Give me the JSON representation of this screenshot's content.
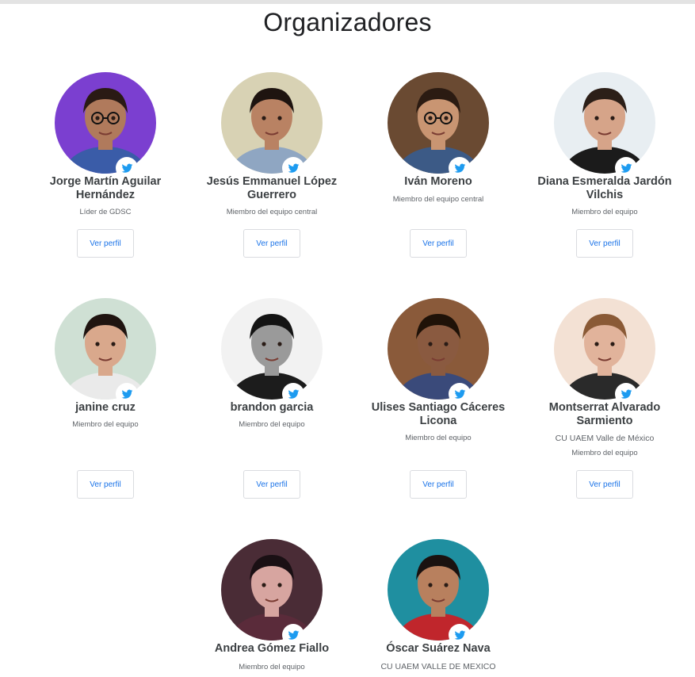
{
  "title": "Organizadores",
  "button_label": "Ver perfil",
  "members": [
    {
      "name": "Jorge Martín Aguilar Hernández",
      "role": "Líder de GDSC",
      "org": "",
      "photo": {
        "bg": "#7b3fd0",
        "skin": "#b07a5c",
        "hair": "#2a1a14",
        "shirt": "#3a5ca8",
        "glasses": true
      }
    },
    {
      "name": "Jesús Emmanuel López Guerrero",
      "role": "Miembro del equipo central",
      "org": "",
      "photo": {
        "bg": "#d8d2b4",
        "skin": "#b98263",
        "hair": "#1e1410",
        "shirt": "#8fa6c2",
        "glasses": false
      }
    },
    {
      "name": "Iván Moreno",
      "role": "Miembro del equipo central",
      "org": "",
      "photo": {
        "bg": "#6a4a32",
        "skin": "#c99572",
        "hair": "#2b1b12",
        "shirt": "#3c5a86",
        "glasses": true
      }
    },
    {
      "name": "Diana Esmeralda Jardón Vilchis",
      "role": "Miembro del equipo",
      "org": "",
      "photo": {
        "bg": "#e8eef2",
        "skin": "#d6a489",
        "hair": "#2c1f18",
        "shirt": "#1b1b1b",
        "glasses": false
      }
    },
    {
      "name": "janine cruz",
      "role": "Miembro del equipo",
      "org": "",
      "photo": {
        "bg": "#cfe0d4",
        "skin": "#d9a88c",
        "hair": "#1f1410",
        "shirt": "#eaeaea",
        "glasses": false
      }
    },
    {
      "name": "brandon garcia",
      "role": "Miembro del equipo",
      "org": "",
      "photo": {
        "bg": "#f2f2f2",
        "skin": "#9a9a9a",
        "hair": "#141414",
        "shirt": "#1c1c1c",
        "glasses": false
      }
    },
    {
      "name": "Ulises Santiago Cáceres Licona",
      "role": "Miembro del equipo",
      "org": "",
      "photo": {
        "bg": "#8a5a3a",
        "skin": "#8a5a40",
        "hair": "#1f1208",
        "shirt": "#3a4a7a",
        "glasses": false
      }
    },
    {
      "name": "Montserrat Alvarado Sarmiento",
      "role": "Miembro del equipo",
      "org": "CU UAEM Valle de México",
      "photo": {
        "bg": "#f3e1d4",
        "skin": "#e1b39b",
        "hair": "#8a5a36",
        "shirt": "#2a2a2a",
        "glasses": false
      }
    },
    {
      "name": "Andrea Gómez Fiallo",
      "role": "Miembro del equipo",
      "org": "",
      "photo": {
        "bg": "#4a2c36",
        "skin": "#d7a5a0",
        "hair": "#1a1014",
        "shirt": "#5a2b3a",
        "glasses": false
      }
    },
    {
      "name": "Óscar Suárez Nava",
      "role": "",
      "org": "CU UAEM VALLE DE MEXICO",
      "photo": {
        "bg": "#1f8fa0",
        "skin": "#b8805e",
        "hair": "#1a1210",
        "shirt": "#c0262c",
        "glasses": false
      }
    }
  ]
}
